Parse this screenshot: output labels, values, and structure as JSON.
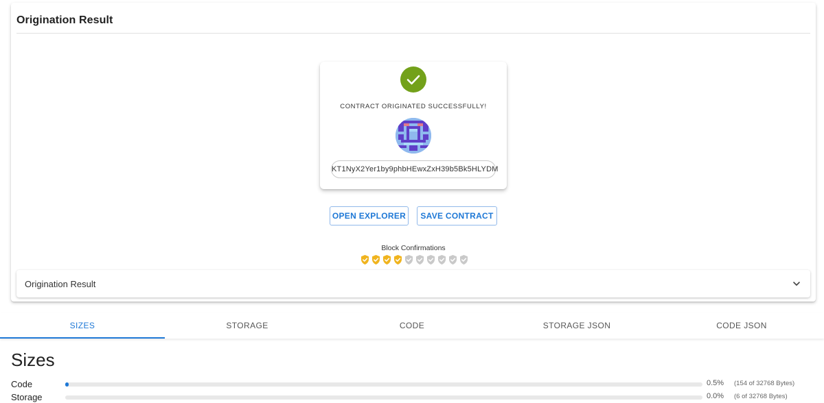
{
  "page_title": "Origination Result",
  "result_card": {
    "success_text": "CONTRACT ORIGINATED SUCCESSFULLY!",
    "contract_address": "KT1NyX2Yer1by9phbHEwxZxH39b5Bk5HLYDM"
  },
  "buttons": {
    "open_explorer": "OPEN EXPLORER",
    "save_contract": "SAVE CONTRACT"
  },
  "confirmations": {
    "label": "Block Confirmations",
    "confirmed": 4,
    "total": 10,
    "confirmed_color": "#f0b41e",
    "pending_color": "#c9c9c9"
  },
  "expansion": {
    "title": "Origination Result"
  },
  "tabs": [
    {
      "label": "SIZES",
      "active": true
    },
    {
      "label": "STORAGE",
      "active": false
    },
    {
      "label": "CODE",
      "active": false
    },
    {
      "label": "STORAGE JSON",
      "active": false
    },
    {
      "label": "CODE JSON",
      "active": false
    }
  ],
  "sizes": {
    "title": "Sizes",
    "rows": [
      {
        "label": "Code",
        "percent": "0.5%",
        "fraction": 0.005,
        "bytes": "(154 of 32768 Bytes)"
      },
      {
        "label": "Storage",
        "percent": "0.0%",
        "fraction": 0.0,
        "bytes": "(6 of 32768 Bytes)"
      }
    ]
  },
  "colors": {
    "accent": "#1e78d6",
    "success": "#73a11a"
  }
}
